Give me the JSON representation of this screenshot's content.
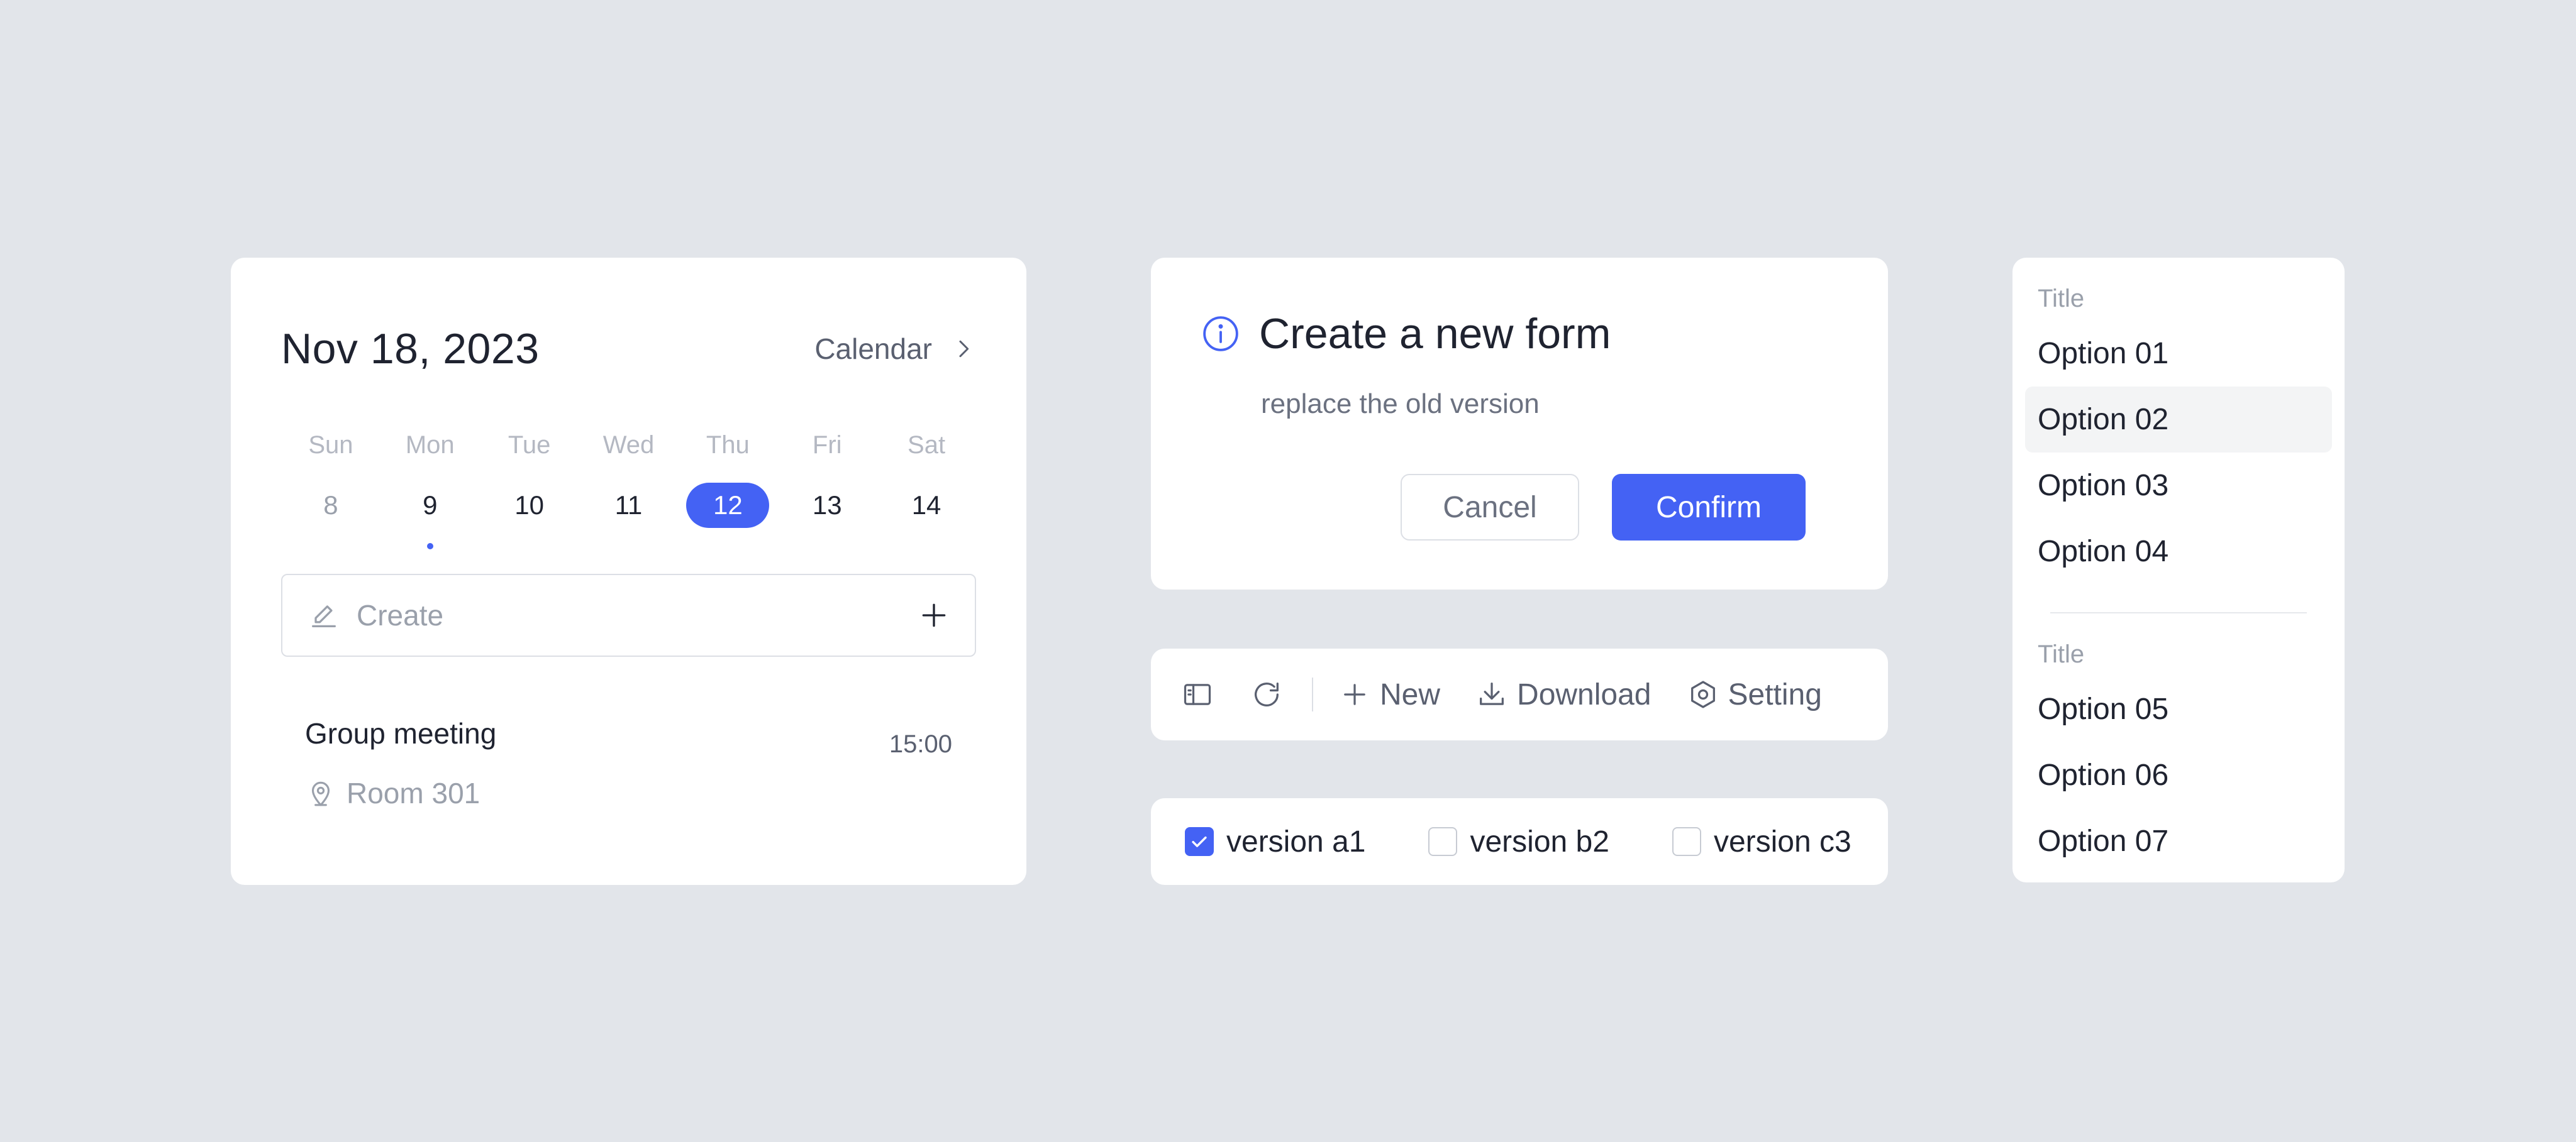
{
  "calendar": {
    "date_title": "Nov 18, 2023",
    "link_label": "Calendar",
    "weekdays": [
      "Sun",
      "Mon",
      "Tue",
      "Wed",
      "Thu",
      "Fri",
      "Sat"
    ],
    "days": [
      "8",
      "9",
      "10",
      "11",
      "12",
      "13",
      "14"
    ],
    "selected_day": "12",
    "create_placeholder": "Create",
    "event": {
      "title": "Group meeting",
      "time": "15:00",
      "location": "Room 301"
    }
  },
  "dialog": {
    "title": "Create a new form",
    "subtitle": "replace the old version",
    "cancel_label": "Cancel",
    "confirm_label": "Confirm"
  },
  "toolbar": {
    "new_label": "New",
    "download_label": "Download",
    "setting_label": "Setting"
  },
  "checkboxes": [
    {
      "label": "version a1",
      "checked": true
    },
    {
      "label": "version b2",
      "checked": false
    },
    {
      "label": "version c3",
      "checked": false
    }
  ],
  "menu": {
    "groups": [
      {
        "title": "Title",
        "items": [
          "Option 01",
          "Option 02",
          "Option 03",
          "Option 04"
        ]
      },
      {
        "title": "Title",
        "items": [
          "Option 05",
          "Option 06",
          "Option 07"
        ]
      }
    ],
    "active_item": "Option 02"
  },
  "colors": {
    "accent": "#4462f4",
    "background": "#e2e5ea",
    "card": "#ffffff"
  }
}
